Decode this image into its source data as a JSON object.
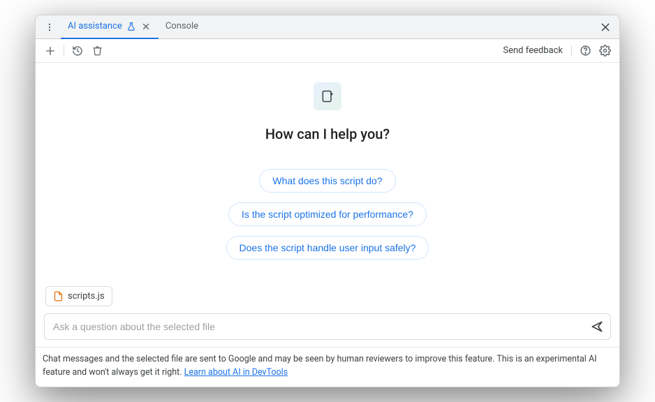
{
  "tabs": {
    "active": {
      "label": "AI assistance"
    },
    "other": {
      "label": "Console"
    }
  },
  "toolbar": {
    "feedback": "Send feedback"
  },
  "main": {
    "heading": "How can I help you?",
    "suggestions": [
      "What does this script do?",
      "Is the script optimized for performance?",
      "Does the script handle user input safely?"
    ],
    "file": "scripts.js",
    "input_placeholder": "Ask a question about the selected file"
  },
  "footer": {
    "text_before": "Chat messages and the selected file are sent to Google and may be seen by human reviewers to improve this feature. This is an experimental AI feature and won't always get it right. ",
    "link": "Learn about AI in DevTools"
  },
  "icons": {
    "more": "more-vertical-icon",
    "flask": "flask-icon",
    "close": "close-icon",
    "plus": "plus-icon",
    "history": "history-icon",
    "trash": "trash-icon",
    "help": "help-circle-icon",
    "settings": "gear-icon",
    "spark": "sparkle-icon",
    "file": "file-icon",
    "send": "send-icon"
  },
  "colors": {
    "accent": "#1a73e8",
    "file_icon": "#e8710a"
  }
}
